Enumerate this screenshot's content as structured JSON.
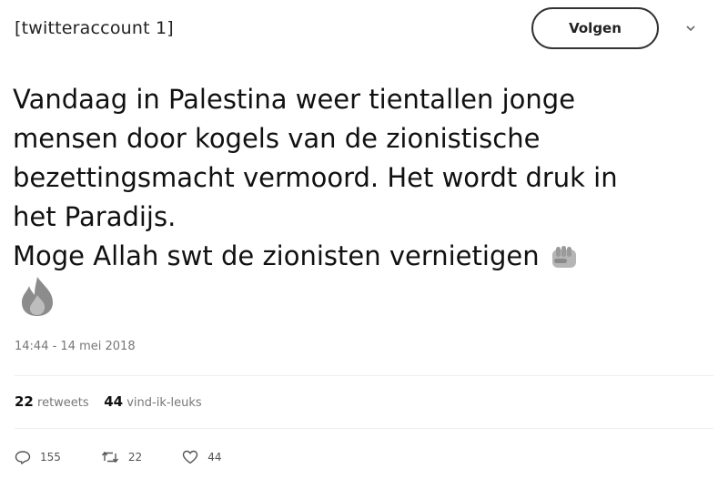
{
  "account": {
    "name": "[twitteraccount 1]"
  },
  "follow_button": {
    "label": "Volgen"
  },
  "tweet": {
    "lines": [
      "Vandaag in Palestina weer tientallen jonge",
      "mensen door kogels van de zionistische",
      "bezettingsmacht vermoord. Het wordt druk in",
      "het Paradijs.",
      "Moge Allah swt de zionisten vernietigen"
    ],
    "emojis": [
      "fist-emoji",
      "fire-emoji"
    ],
    "timestamp": "14:44 - 14 mei 2018"
  },
  "stats": {
    "retweets_count": "22",
    "retweets_label": "retweets",
    "likes_count": "44",
    "likes_label": "vind-ik-leuks"
  },
  "actions": {
    "reply_count": "155",
    "retweet_count": "22",
    "like_count": "44"
  },
  "icons": {
    "caret": "chevron-down-icon",
    "reply": "reply-icon",
    "retweet": "retweet-icon",
    "like": "heart-icon"
  },
  "colors": {
    "text": "#111111",
    "muted": "#777777",
    "background": "#ffffff"
  }
}
